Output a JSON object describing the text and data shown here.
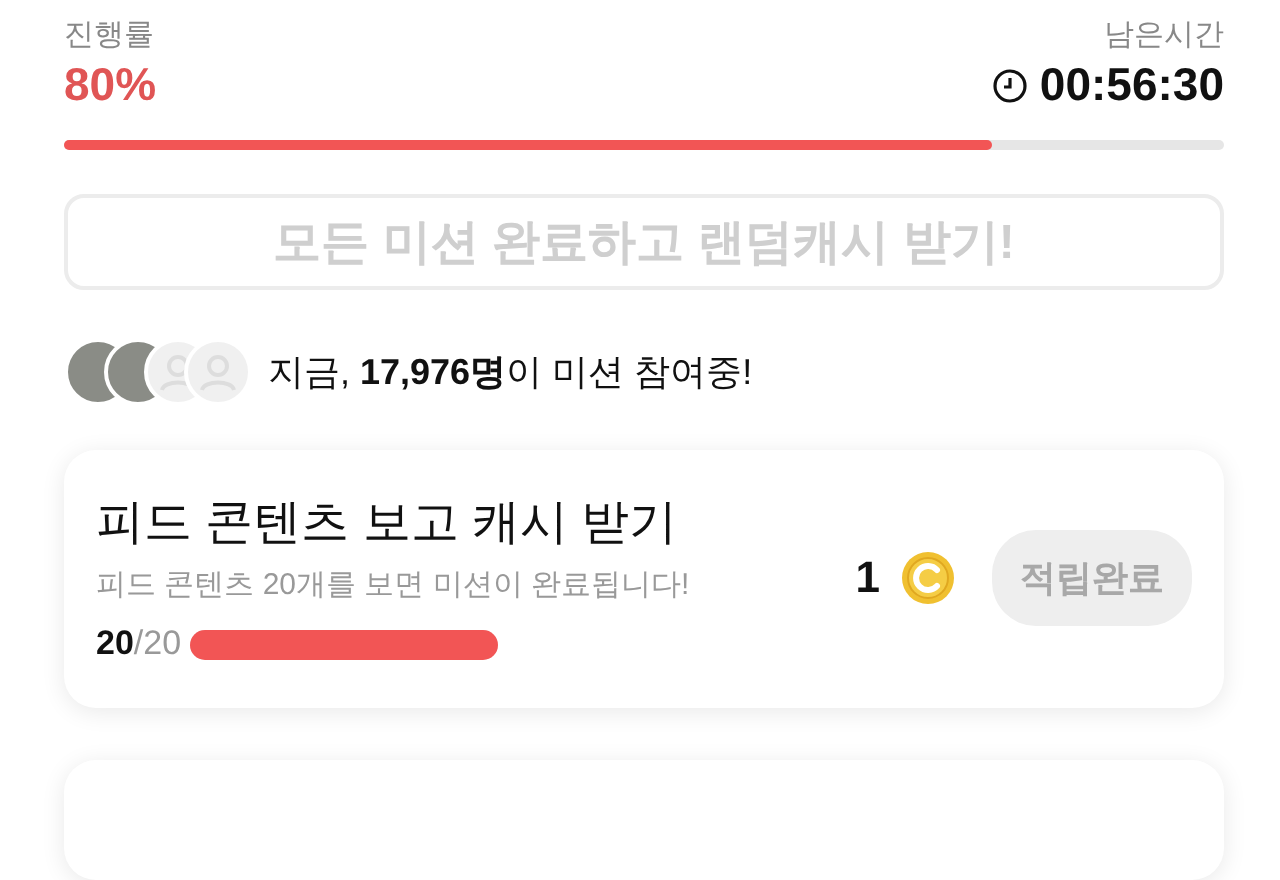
{
  "progress": {
    "label": "진행률",
    "value": "80%",
    "level": 0.8
  },
  "timer": {
    "label": "남은시간",
    "value": "00:56:30"
  },
  "complete_button": {
    "label": "모든 미션 완료하고 랜덤캐시 받기!",
    "disabled": true
  },
  "participants": {
    "avatars": [
      {
        "kind": "photo"
      },
      {
        "kind": "photo"
      },
      {
        "kind": "default"
      },
      {
        "kind": "default"
      }
    ],
    "text": "지금, **17,976명**이 미션 참여중!"
  },
  "missions": [
    {
      "title": "피드 콘텐츠 보고 캐시 받기",
      "description": "피드 콘텐츠 20개를 보면 미션이 완료됩니다!",
      "done": "20",
      "total": "/20",
      "level": 1,
      "reward": "1",
      "button": "적립완료",
      "claimed": true
    }
  ]
}
